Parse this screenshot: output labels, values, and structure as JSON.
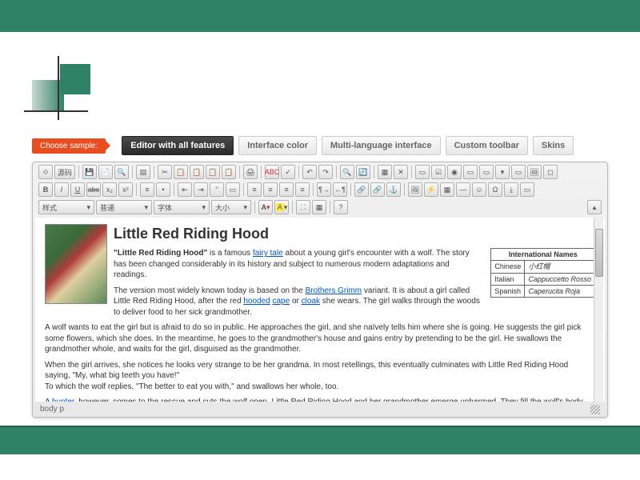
{
  "chooseSample": "Choose sample:",
  "tabs": [
    "Editor with all features",
    "Interface color",
    "Multi-language interface",
    "Custom toolbar",
    "Skins"
  ],
  "toolbar": {
    "source": "源码",
    "style": "样式",
    "format": "普通",
    "font": "字体",
    "size": "大小"
  },
  "content": {
    "title": "Little Red Riding Hood",
    "p1_bold": "\"Little Red Riding Hood\"",
    "p1_a": " is a famous ",
    "p1_link1": "fairy tale",
    "p1_b": " about a young girl's encounter with a wolf. The story has been changed considerably in its history and subject to numerous modern adaptations and readings.",
    "p2_a": "The version most widely known today is based on the ",
    "p2_link1": "Brothers Grimm",
    "p2_b": " variant. It is about a girl called Little Red Riding Hood, after the red ",
    "p2_link2": "hooded",
    "p2_c": " ",
    "p2_link3": "cape",
    "p2_d": " or ",
    "p2_link4": "cloak",
    "p2_e": " she wears. The girl walks through the woods to deliver food to her sick grandmother.",
    "p3": "A wolf wants to eat the girl but is afraid to do so in public. He approaches the girl, and she naïvely tells him where she is going. He suggests the girl pick some flowers, which she does. In the meantime, he goes to the grandmother's house and gains entry by pretending to be the girl. He swallows the grandmother whole, and waits for the girl, disguised as the grandmother.",
    "p4": "When the girl arrives, she notices he looks very strange to be her grandma. In most retellings, this eventually culminates with Little Red Riding Hood saying, \"My, what big teeth you have!\"",
    "p4b": "To which the wolf replies, \"The better to eat you with,\" and swallows her whole, too.",
    "p5_a": "A ",
    "p5_link": "hunter",
    "p5_b": ", however, comes to the rescue and cuts the wolf open. Little Red Riding Hood and her grandmother emerge unharmed. They fill the wolf's body with"
  },
  "table": {
    "header": "International Names",
    "rows": [
      {
        "lang": "Chinese",
        "name": "小红帽"
      },
      {
        "lang": "Italian",
        "name": "Cappuccetto Rosso"
      },
      {
        "lang": "Spanish",
        "name": "Caperucita Roja"
      }
    ]
  },
  "status": "body  p"
}
